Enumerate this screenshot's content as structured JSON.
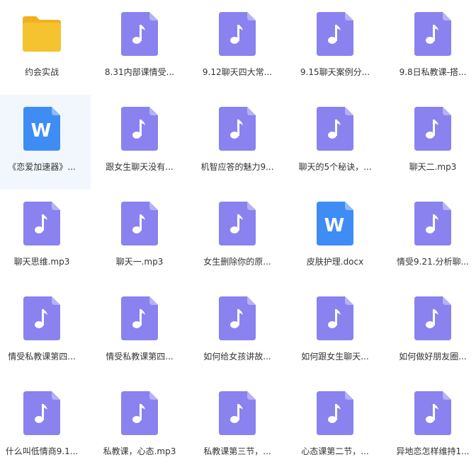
{
  "colors": {
    "audio": "#8a82ee",
    "audio_fold": "#b6b0f6",
    "doc": "#3f8cf5",
    "doc_fold": "#8cbdfa",
    "folder": "#f5c230",
    "folder_tab": "#f0b21c",
    "selected_bg": "#f2f7fd",
    "label": "#333333"
  },
  "files": [
    {
      "type": "folder",
      "icon": "folder-icon",
      "name": "约会实战"
    },
    {
      "type": "audio",
      "icon": "music-note-icon",
      "name": "8.31内部课情受..."
    },
    {
      "type": "audio",
      "icon": "music-note-icon",
      "name": "9.12聊天四大常..."
    },
    {
      "type": "audio",
      "icon": "music-note-icon",
      "name": "9.15聊天案例分..."
    },
    {
      "type": "audio",
      "icon": "music-note-icon",
      "name": "9.8日私教课-搭..."
    },
    {
      "type": "doc",
      "icon": "word-doc-icon",
      "name": "《恋爱加速器》...",
      "selected": true
    },
    {
      "type": "audio",
      "icon": "music-note-icon",
      "name": "跟女生聊天没有..."
    },
    {
      "type": "audio",
      "icon": "music-note-icon",
      "name": "机智应答的魅力9..."
    },
    {
      "type": "audio",
      "icon": "music-note-icon",
      "name": "聊天的5个秘诀，..."
    },
    {
      "type": "audio",
      "icon": "music-note-icon",
      "name": "聊天二.mp3"
    },
    {
      "type": "audio",
      "icon": "music-note-icon",
      "name": "聊天思维.mp3"
    },
    {
      "type": "audio",
      "icon": "music-note-icon",
      "name": "聊天一.mp3"
    },
    {
      "type": "audio",
      "icon": "music-note-icon",
      "name": "女生删除你的原..."
    },
    {
      "type": "doc",
      "icon": "word-doc-icon",
      "name": "皮肤护理.docx"
    },
    {
      "type": "audio",
      "icon": "music-note-icon",
      "name": "情受9.21.分析聊..."
    },
    {
      "type": "audio",
      "icon": "music-note-icon",
      "name": "情受私教课第四..."
    },
    {
      "type": "audio",
      "icon": "music-note-icon",
      "name": "情受私教课第四..."
    },
    {
      "type": "audio",
      "icon": "music-note-icon",
      "name": "如何给女孩讲故..."
    },
    {
      "type": "audio",
      "icon": "music-note-icon",
      "name": "如何跟女生聊天..."
    },
    {
      "type": "audio",
      "icon": "music-note-icon",
      "name": "如何做好朋友圈..."
    },
    {
      "type": "audio",
      "icon": "music-note-icon",
      "name": "什么叫低情商9.1..."
    },
    {
      "type": "audio",
      "icon": "music-note-icon",
      "name": "私教课，心态.mp3"
    },
    {
      "type": "audio",
      "icon": "music-note-icon",
      "name": "私教课第三节，..."
    },
    {
      "type": "audio",
      "icon": "music-note-icon",
      "name": "心态课第二节，..."
    },
    {
      "type": "audio",
      "icon": "music-note-icon",
      "name": "异地恋怎样维持1..."
    }
  ],
  "doc_letter": "W"
}
